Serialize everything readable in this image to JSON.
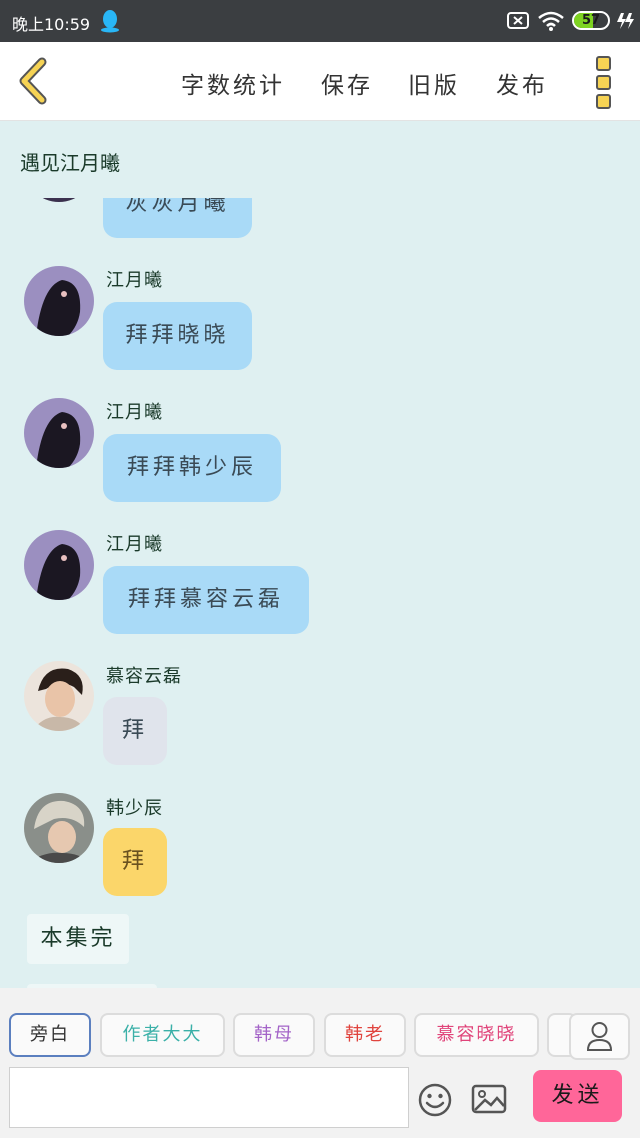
{
  "status": {
    "time": "晚上10:59",
    "battery": "57",
    "battery_level": 0.57
  },
  "toolbar": {
    "word_count": "字数统计",
    "save": "保存",
    "old_version": "旧版",
    "publish": "发布"
  },
  "chat": {
    "title": "遇见江月曦",
    "top_partial_text": "灰灰月曦",
    "messages": [
      {
        "name": "江月曦",
        "text": "拜拜晓晓"
      },
      {
        "name": "江月曦",
        "text": "拜拜韩少辰"
      },
      {
        "name": "江月曦",
        "text": "拜拜慕容云磊"
      },
      {
        "name": "慕容云磊",
        "text": "拜"
      },
      {
        "name": "韩少辰",
        "text": "拜"
      }
    ],
    "end_label": "本集完"
  },
  "roles": [
    {
      "label": "旁白",
      "color": "#333333"
    },
    {
      "label": "作者大大",
      "color": "#3bb0a8"
    },
    {
      "label": "韩母",
      "color": "#a464c8"
    },
    {
      "label": "韩老",
      "color": "#e0443e"
    },
    {
      "label": "慕容晓晓",
      "color": "#e0447a"
    }
  ],
  "composer": {
    "send": "发送",
    "input_value": ""
  },
  "icons": [
    "back-chevron-icon",
    "more-menu-icon",
    "person-icon",
    "emoji-icon",
    "image-icon",
    "qq-icon",
    "wifi-icon",
    "battery-icon"
  ]
}
